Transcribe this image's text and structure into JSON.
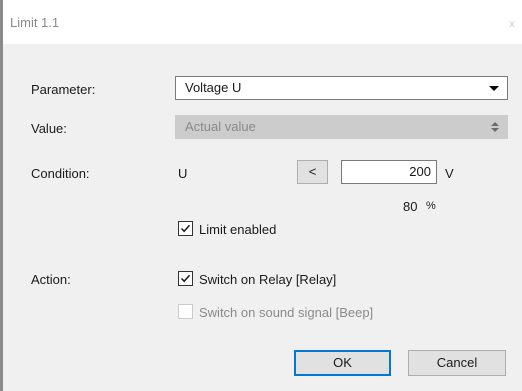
{
  "window": {
    "title": "Limit 1.1",
    "close_glyph": "x"
  },
  "parameter": {
    "label": "Parameter:",
    "value": "Voltage U"
  },
  "value": {
    "label": "Value:",
    "value": "Actual value"
  },
  "condition": {
    "label": "Condition:",
    "symbol": "U",
    "operator": "<",
    "threshold": "200",
    "unit": "V",
    "percent_value": "80",
    "percent_unit": "%"
  },
  "limit_enabled": {
    "label": "Limit enabled",
    "checked": true
  },
  "action": {
    "label": "Action:",
    "relay": {
      "label": "Switch on Relay [Relay]",
      "checked": true
    },
    "sound": {
      "label": "Switch on sound signal [Beep]",
      "checked": false,
      "enabled": false
    }
  },
  "buttons": {
    "ok": "OK",
    "cancel": "Cancel"
  }
}
